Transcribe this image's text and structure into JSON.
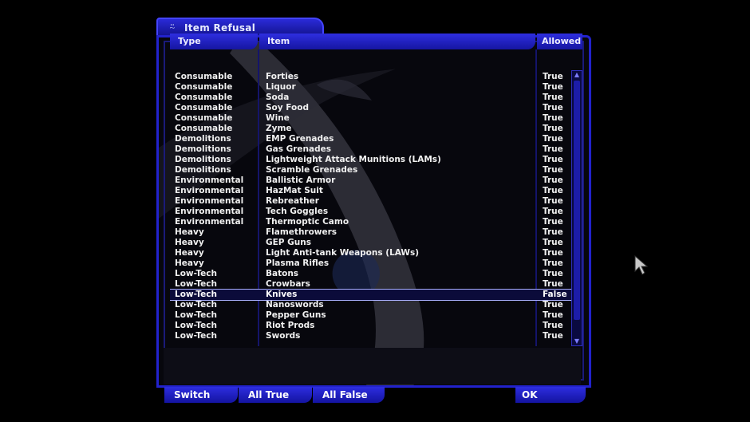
{
  "window": {
    "title": "Item Refusal",
    "title_icon": "dx-emblem-icon"
  },
  "headers": {
    "type": "Type",
    "item": "Item",
    "allowed": "Allowed"
  },
  "rows": [
    {
      "type": "Consumable",
      "item": "Forties",
      "allowed": "True"
    },
    {
      "type": "Consumable",
      "item": "Liquor",
      "allowed": "True"
    },
    {
      "type": "Consumable",
      "item": "Soda",
      "allowed": "True"
    },
    {
      "type": "Consumable",
      "item": "Soy Food",
      "allowed": "True"
    },
    {
      "type": "Consumable",
      "item": "Wine",
      "allowed": "True"
    },
    {
      "type": "Consumable",
      "item": "Zyme",
      "allowed": "True"
    },
    {
      "type": "Demolitions",
      "item": "EMP Grenades",
      "allowed": "True"
    },
    {
      "type": "Demolitions",
      "item": "Gas Grenades",
      "allowed": "True"
    },
    {
      "type": "Demolitions",
      "item": "Lightweight Attack Munitions (LAMs)",
      "allowed": "True"
    },
    {
      "type": "Demolitions",
      "item": "Scramble Grenades",
      "allowed": "True"
    },
    {
      "type": "Environmental",
      "item": "Ballistic Armor",
      "allowed": "True"
    },
    {
      "type": "Environmental",
      "item": "HazMat Suit",
      "allowed": "True"
    },
    {
      "type": "Environmental",
      "item": "Rebreather",
      "allowed": "True"
    },
    {
      "type": "Environmental",
      "item": "Tech Goggles",
      "allowed": "True"
    },
    {
      "type": "Environmental",
      "item": "Thermoptic Camo",
      "allowed": "True"
    },
    {
      "type": "Heavy",
      "item": "Flamethrowers",
      "allowed": "True"
    },
    {
      "type": "Heavy",
      "item": "GEP Guns",
      "allowed": "True"
    },
    {
      "type": "Heavy",
      "item": "Light Anti-tank Weapons (LAWs)",
      "allowed": "True"
    },
    {
      "type": "Heavy",
      "item": "Plasma Rifles",
      "allowed": "True"
    },
    {
      "type": "Low-Tech",
      "item": "Batons",
      "allowed": "True"
    },
    {
      "type": "Low-Tech",
      "item": "Crowbars",
      "allowed": "True"
    },
    {
      "type": "Low-Tech",
      "item": "Knives",
      "allowed": "False",
      "selected": true
    },
    {
      "type": "Low-Tech",
      "item": "Nanoswords",
      "allowed": "True"
    },
    {
      "type": "Low-Tech",
      "item": "Pepper Guns",
      "allowed": "True"
    },
    {
      "type": "Low-Tech",
      "item": "Riot Prods",
      "allowed": "True"
    },
    {
      "type": "Low-Tech",
      "item": "Swords",
      "allowed": "True"
    }
  ],
  "buttons": {
    "switch": "Switch",
    "all_true": "All True",
    "all_false": "All False",
    "ok": "OK"
  },
  "colors": {
    "frame": "#2222cc",
    "header": "#2e2ee0",
    "background": "#000000"
  }
}
